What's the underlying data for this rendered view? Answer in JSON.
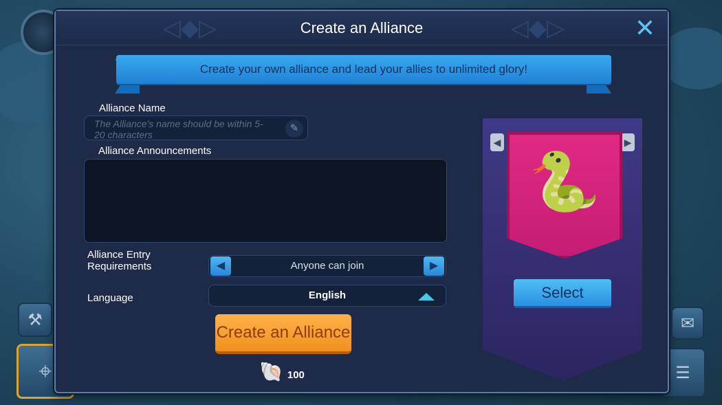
{
  "dialog": {
    "title": "Create an Alliance",
    "banner_text": "Create your own alliance and lead your allies to unlimited glory!"
  },
  "form": {
    "name_label": "Alliance Name",
    "name_placeholder": "The Alliance's name should be within 5-20 characters",
    "announcements_label": "Alliance Announcements",
    "announcements_value": "",
    "entry_label": "Alliance Entry Requirements",
    "entry_value": "Anyone can join",
    "language_label": "Language",
    "language_value": "English"
  },
  "actions": {
    "create_label": "Create an Alliance",
    "cost_value": "100",
    "select_label": "Select"
  },
  "icons": {
    "close": "close-icon",
    "edit": "pencil-icon",
    "cost": "shell-icon",
    "emblem": "snake-head-emblem"
  },
  "colors": {
    "dialog_bg": "#1d2b49",
    "ribbon": "#2a93e0",
    "create_button": "#f5a030",
    "flag": "#d8247e",
    "banner_back": "#36307a"
  }
}
